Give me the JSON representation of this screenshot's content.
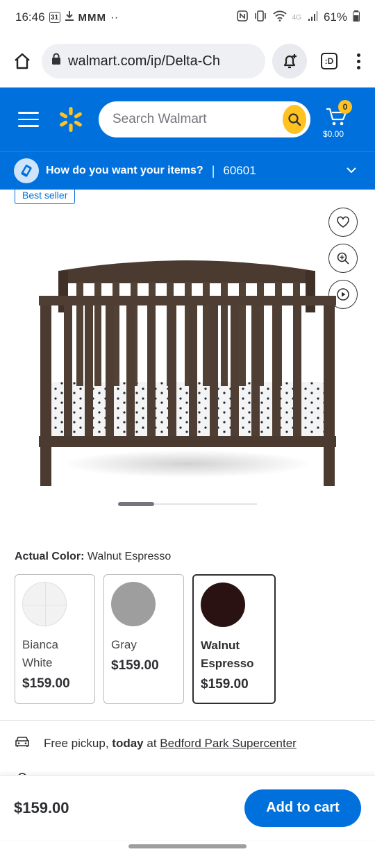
{
  "status_bar": {
    "time": "16:46",
    "calendar_day": "31",
    "notif_glyphs": "MMM",
    "dots": "··",
    "network": "4G",
    "battery": "61%"
  },
  "browser": {
    "url": "walmart.com/ip/Delta-Ch",
    "tab_label": ":D"
  },
  "header": {
    "search_placeholder": "Search Walmart",
    "cart_count": "0",
    "cart_total": "$0.00",
    "brand_color": "#0071dc",
    "accent_color": "#ffc220"
  },
  "delivery": {
    "question": "How do you want your items?",
    "separator": "|",
    "zip": "60601"
  },
  "product": {
    "badge": "Best seller",
    "image_alt": "Brown wooden crib with polka dot mattress",
    "carousel": {
      "current": 1,
      "total": 4
    },
    "color_label": "Actual Color:",
    "color_value": "Walnut Espresso",
    "swatches": [
      {
        "name": "Bianca White",
        "price": "$159.00",
        "color": "#f2f2f2",
        "selected": false
      },
      {
        "name": "Gray",
        "price": "$159.00",
        "color": "#9e9e9e",
        "selected": false
      },
      {
        "name": "Walnut Espresso",
        "price": "$159.00",
        "color": "#2b1212",
        "selected": true
      }
    ]
  },
  "fulfillment": {
    "pickup_prefix": "Free pickup,",
    "pickup_day": "today",
    "pickup_at": "at",
    "store": "Bedford Park Supercenter"
  },
  "bottom": {
    "price": "$159.00",
    "add_to_cart": "Add to cart"
  }
}
